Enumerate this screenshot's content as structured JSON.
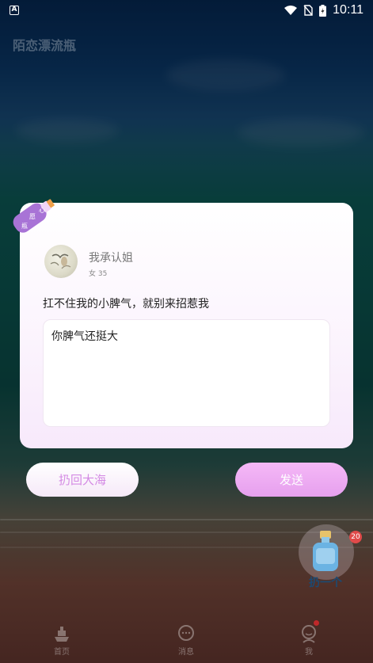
{
  "status_bar": {
    "time": "10:11",
    "left_icon": "A"
  },
  "app": {
    "title": "陌恋漂流瓶"
  },
  "dialog": {
    "bottle_tag": [
      "心",
      "愿",
      "瓶"
    ],
    "user": {
      "name": "我承认姐",
      "meta": "女 35"
    },
    "message": "扛不住我的小脾气，就别来招惹我",
    "reply_value": "你脾气还挺大"
  },
  "actions": {
    "throw_back": "扔回大海",
    "send": "发送"
  },
  "float": {
    "label": "扔一个",
    "badge": "20"
  },
  "tabs": [
    {
      "label": "首页",
      "icon": "ship-icon"
    },
    {
      "label": "消息",
      "icon": "chat-bubble-icon"
    },
    {
      "label": "我",
      "icon": "profile-icon"
    }
  ],
  "colors": {
    "accent": "#e6a0ee",
    "accent_text": "#d48ae4",
    "badge": "#e04a4a"
  }
}
